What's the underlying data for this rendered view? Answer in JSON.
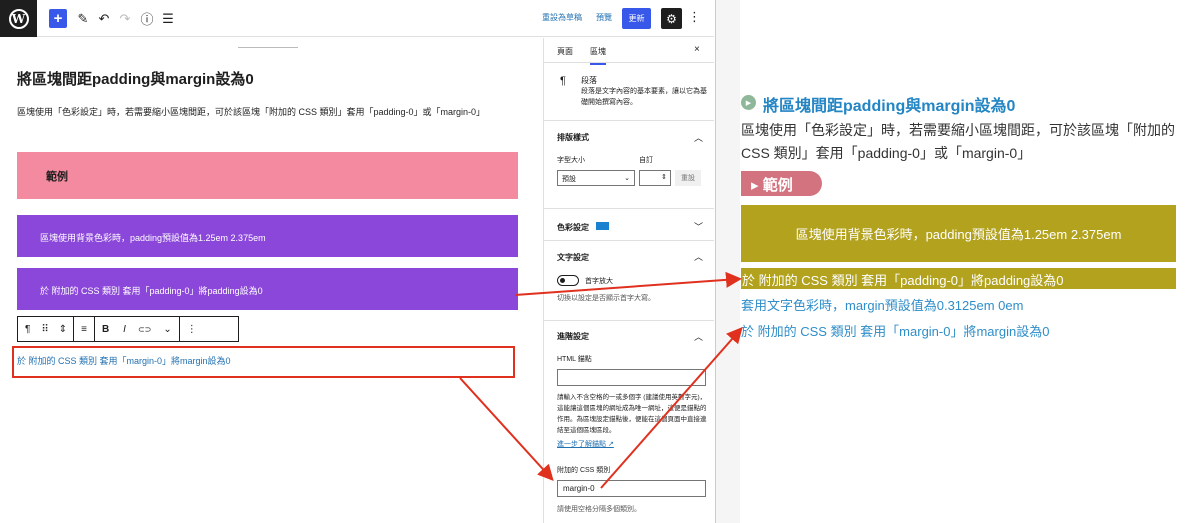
{
  "topbar": {
    "logo": "W",
    "add": "+",
    "pencil": "✎",
    "undo": "↶",
    "redo": "↷",
    "info": "ⓘ",
    "list": "☰",
    "save_draft": "重設為草稿",
    "preview": "預覽",
    "update": "更新",
    "gear": "⚙",
    "more": "⋮"
  },
  "editor": {
    "title": "將區塊間距padding與margin設為0",
    "paragraph": "區塊使用「色彩設定」時，若需要縮小區塊間距，可於該區塊「附加的 CSS 類別」套用「padding-0」或「margin-0」",
    "example_label": "範例",
    "purple_block_1": "區塊使用背景色彩時，padding預設值為1.25em 2.375em",
    "purple_block_2": "於 附加的 CSS 類別 套用「padding-0」將padding設為0",
    "margin_text": "於 附加的 CSS 類別 套用「margin-0」將margin設為0",
    "toolbar": {
      "paragraph": "¶",
      "drag": "⠿",
      "move": "⇕",
      "align": "≡",
      "bold": "B",
      "italic": "I",
      "link": "⊂⊃",
      "chevron": "⌄",
      "more": "⋮"
    }
  },
  "sidebar": {
    "tab_page": "頁面",
    "tab_block": "區塊",
    "close": "×",
    "para_icon": "¶",
    "para_title": "段落",
    "para_desc": "段落是文字內容的基本要素，讓以它為基礎開始撰寫內容。",
    "typography": "排版樣式",
    "font_size": "字型大小",
    "custom": "自訂",
    "select_value": "預設",
    "select_chevron": "⌄",
    "num_arrows": "⇕",
    "reset": "重設",
    "color_settings": "色彩設定",
    "text_settings": "文字設定",
    "drop_cap": "首字放大",
    "drop_cap_help": "切換以設定是否顯示首字大寫。",
    "advanced": "進階設定",
    "html_anchor": "HTML 錨點",
    "anchor_help": "請輸入不含空格的一或多個字 (建議使用英數字元)，這能讓這個區塊的網址成為唯一網址，這便是錨點的作用。為區塊設定錨點後，便能在這個頁面中直接連結至這個區塊區段。",
    "learn_more": "進一步了解錨點 ↗",
    "css_class": "附加的 CSS 類別",
    "css_class_value": "margin-0",
    "css_class_help": "請使用空格分隔多個類別。",
    "chevron_up": "︿",
    "chevron_down": "﹀"
  },
  "preview": {
    "title_icon": "▶",
    "title": "將區塊間距padding與margin設為0",
    "paragraph": "區塊使用「色彩設定」時，若需要縮小區塊間距，可於該區塊「附加的 CSS 類別」套用「padding-0」或「margin-0」",
    "example_label": "▸ 範例",
    "olive_block_1": "區塊使用背景色彩時，padding預設值為1.25em 2.375em",
    "olive_block_2": "於 附加的 CSS 類別 套用「padding-0」將padding設為0",
    "line_3": "套用文字色彩時，margin預設值為0.3125em 0em",
    "line_4": "於 附加的 CSS 類別 套用「margin-0」將margin設為0"
  },
  "colors": {
    "accent": "#3858e9",
    "purple": "#8b47d9",
    "pink": "#f48aa0",
    "olive": "#b2a21e",
    "link_blue": "#2f8ec9",
    "arrow_red": "#e0301e"
  }
}
